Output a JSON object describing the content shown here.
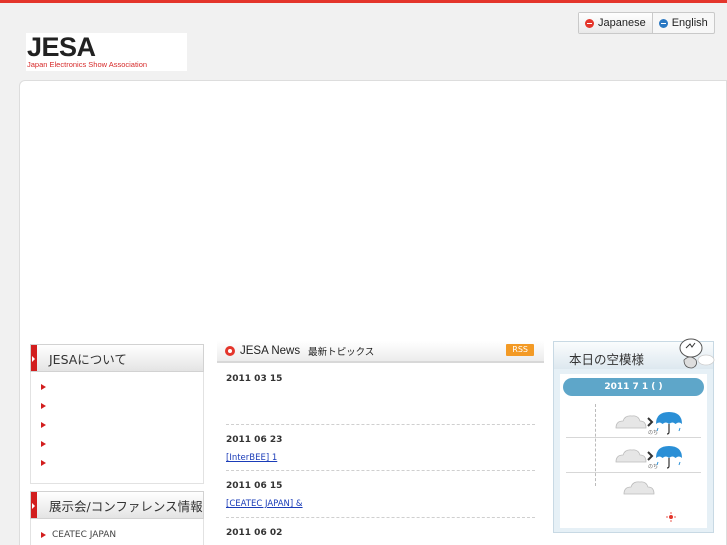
{
  "header": {
    "logo_main": "JESA",
    "logo_sub": "Japan Electronics Show Association",
    "languages": [
      {
        "label": "Japanese",
        "active": true
      },
      {
        "label": "English",
        "active": false
      }
    ]
  },
  "sidebar": {
    "section1": {
      "title": "JESAについて",
      "items": [
        "",
        "",
        "",
        "",
        ""
      ]
    },
    "section2": {
      "title": "展示会/コンファレンス情報",
      "items": [
        "CEATEC JAPAN"
      ]
    }
  },
  "news": {
    "title": "JESA News",
    "subtitle": "最新トピックス",
    "rss_label": "RSS",
    "items": [
      {
        "date": "2011 03 15",
        "link": ""
      },
      {
        "date": "2011 06 23",
        "link": "[InterBEE]   1"
      },
      {
        "date": "2011 06 15",
        "link": "[CEATEC JAPAN]                &"
      },
      {
        "date": "2011 06 02",
        "link": ""
      }
    ]
  },
  "weather": {
    "title": "本日の空模様",
    "date": "2011  7  1  (  )",
    "rows": [
      {
        "condition": "cloudy-then-rain",
        "later_label": "のち"
      },
      {
        "condition": "cloudy-then-rain",
        "later_label": "のち"
      },
      {
        "condition": "cloudy",
        "later_label": ""
      }
    ],
    "colors": {
      "accent": "#5ea6c9",
      "umbrella": "#2a8fd6",
      "sun": "#e4352b"
    }
  },
  "colors": {
    "brand_red": "#e4352b",
    "link": "#1a3cb8",
    "rss": "#f39a25"
  }
}
